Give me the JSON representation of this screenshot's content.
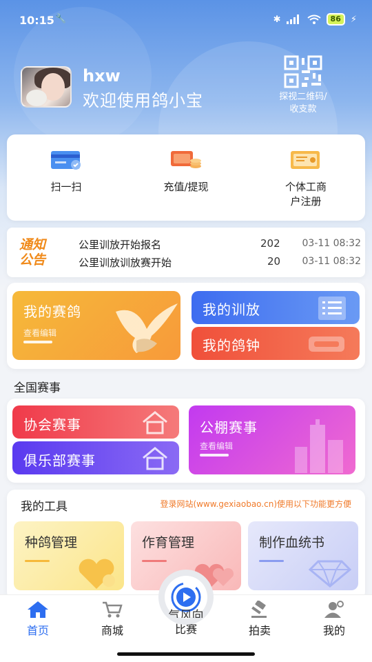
{
  "status_bar": {
    "time": "10:15",
    "battery": "86"
  },
  "profile": {
    "username": "hxw",
    "welcome": "欢迎使用鸽小宝",
    "qr_label_line1": "探视二维码/",
    "qr_label_line2": "收支款"
  },
  "quick_actions": [
    {
      "label": "扫一扫",
      "icon": "card-scan-icon"
    },
    {
      "label": "充值/提现",
      "icon": "wallet-coins-icon"
    },
    {
      "label_line1": "个体工商",
      "label_line2": "户注册",
      "icon": "business-license-icon"
    }
  ],
  "notice": {
    "logo_line1": "通知",
    "logo_line2": "公告",
    "items": [
      {
        "title": "公里训放开始报名",
        "year": "202",
        "date": "03-11 08:32"
      },
      {
        "title": "公里训放训放赛开始",
        "year": "20",
        "date": "03-11 08:32"
      }
    ]
  },
  "my_section": {
    "my_pigeons": "我的赛鸽",
    "my_pigeons_sub": "查看编辑",
    "my_training": "我的训放",
    "my_clock": "我的鸽钟"
  },
  "competitions": {
    "title": "全国赛事",
    "association": "协会赛事",
    "club": "俱乐部赛事",
    "public_loft": "公棚赛事",
    "public_loft_sub": "查看编辑"
  },
  "tools": {
    "title": "我的工具",
    "hint": "登录网站(www.gexiaobao.cn)使用以下功能更方便",
    "items": [
      {
        "label": "种鸽管理",
        "color": "#f6d44a"
      },
      {
        "label": "作育管理",
        "color": "#f07a7a"
      },
      {
        "label": "制作血统书",
        "color": "#8a9cf0"
      }
    ]
  },
  "fab_caption": "气风向",
  "nav": [
    {
      "label": "首页",
      "icon": "home-icon",
      "active": true
    },
    {
      "label": "商城",
      "icon": "cart-icon"
    },
    {
      "label": "比赛",
      "icon": "play-icon"
    },
    {
      "label": "拍卖",
      "icon": "gavel-icon"
    },
    {
      "label": "我的",
      "icon": "user-icon"
    }
  ],
  "colors": {
    "accent": "#2d6ef0",
    "orange_tile": "#f7a93a",
    "blue_tile": "#4a7cf0",
    "red_tile": "#f0553a",
    "association_tile": "#f04a5a",
    "club_tile": "#6a4af0",
    "loft_tile": "#d44af0"
  }
}
